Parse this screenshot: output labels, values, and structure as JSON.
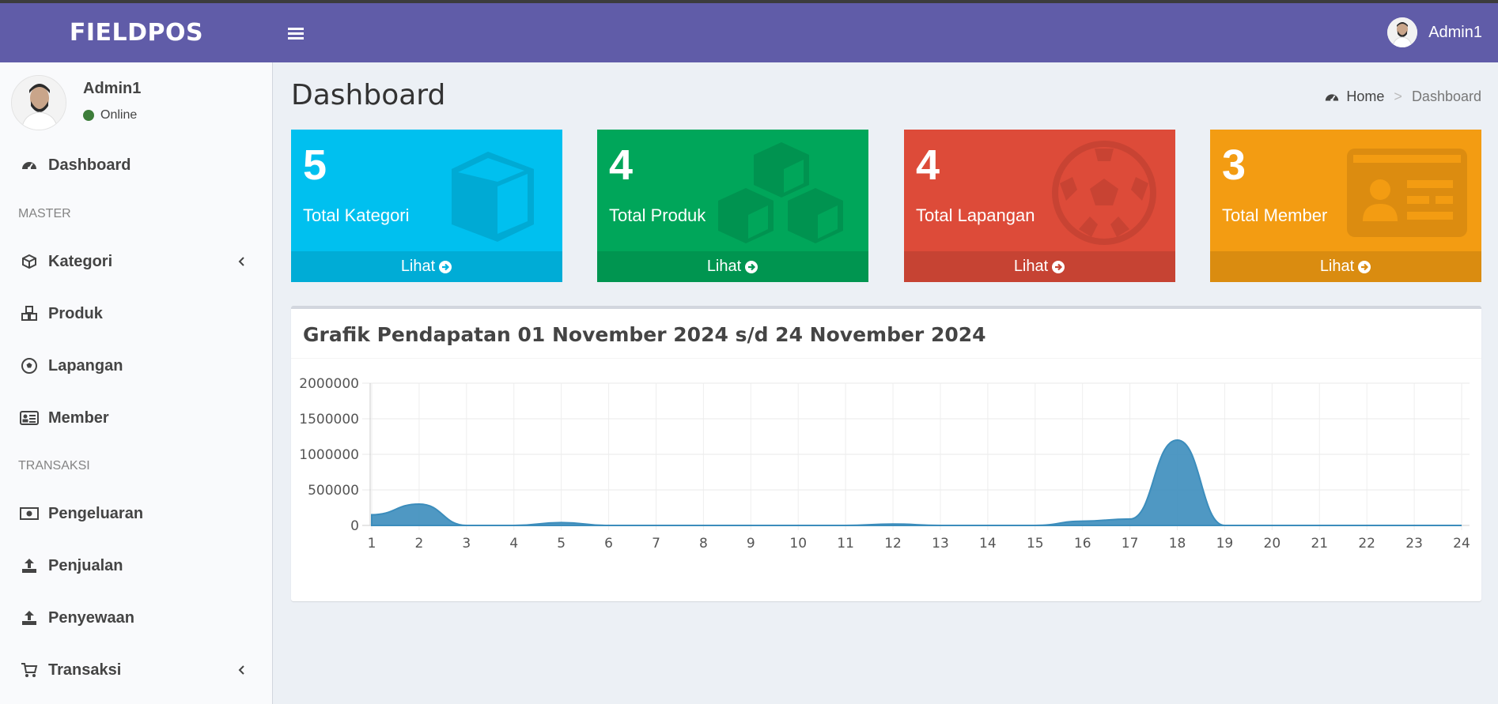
{
  "header": {
    "brand": "FIELDPOS",
    "user_name": "Admin1"
  },
  "sidebar": {
    "user": {
      "name": "Admin1",
      "status": "Online"
    },
    "items": [
      {
        "label": "Dashboard",
        "icon": "dashboard-icon"
      },
      {
        "label": "Kategori",
        "icon": "cube-icon"
      },
      {
        "label": "Produk",
        "icon": "cubes-icon"
      },
      {
        "label": "Lapangan",
        "icon": "soccer-ball-icon"
      },
      {
        "label": "Member",
        "icon": "id-card-icon"
      },
      {
        "label": "Pengeluaran",
        "icon": "money-icon"
      },
      {
        "label": "Penjualan",
        "icon": "upload-icon"
      },
      {
        "label": "Penyewaan",
        "icon": "upload-icon"
      },
      {
        "label": "Transaksi",
        "icon": "cart-icon"
      }
    ],
    "headers": {
      "master": "MASTER",
      "transaksi": "TRANSAKSI"
    }
  },
  "page": {
    "title": "Dashboard",
    "breadcrumb": {
      "home": "Home",
      "sep": ">",
      "current": "Dashboard"
    }
  },
  "stats": [
    {
      "value": "5",
      "label": "Total Kategori",
      "link": "Lihat",
      "color": "#00c0ef"
    },
    {
      "value": "4",
      "label": "Total Produk",
      "link": "Lihat",
      "color": "#00a65a"
    },
    {
      "value": "4",
      "label": "Total Lapangan",
      "link": "Lihat",
      "color": "#dd4b39"
    },
    {
      "value": "3",
      "label": "Total Member",
      "link": "Lihat",
      "color": "#f39c12"
    }
  ],
  "chart": {
    "title": "Grafik Pendapatan 01 November 2024 s/d 24 November 2024"
  },
  "chart_data": {
    "type": "area",
    "x": [
      1,
      2,
      3,
      4,
      5,
      6,
      7,
      8,
      9,
      10,
      11,
      12,
      13,
      14,
      15,
      16,
      17,
      18,
      19,
      20,
      21,
      22,
      23,
      24
    ],
    "series": [
      {
        "values": [
          150000,
          300000,
          0,
          0,
          40000,
          0,
          0,
          0,
          0,
          0,
          0,
          20000,
          0,
          0,
          0,
          60000,
          90000,
          1200000,
          0,
          0,
          0,
          0,
          0,
          0
        ]
      }
    ],
    "yticks": [
      "2000000",
      "1500000",
      "1000000",
      "500000",
      "0"
    ],
    "ylim": [
      0,
      2000000
    ],
    "grid": true,
    "color": "#3c8dbc"
  }
}
